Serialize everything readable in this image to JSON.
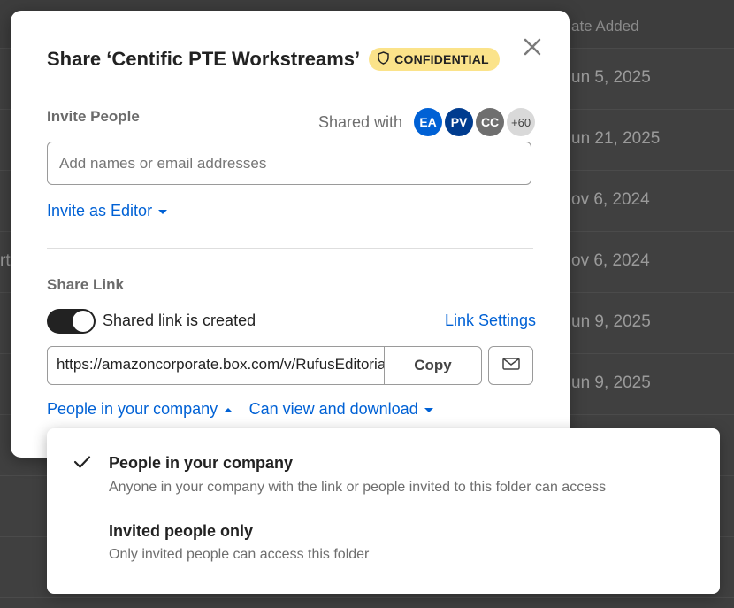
{
  "background": {
    "header_label": "ate Added",
    "rows": [
      {
        "date": "un 5, 2025"
      },
      {
        "date": "un 21, 2025"
      },
      {
        "date": "ov 6, 2024"
      },
      {
        "date": "ov 6, 2024",
        "left_fragment": "rt"
      },
      {
        "date": "un 9, 2025"
      },
      {
        "date": "un 9, 2025"
      }
    ]
  },
  "modal": {
    "title": "Share ‘Centific PTE Workstreams’",
    "badge": "CONFIDENTIAL",
    "invite_section_label": "Invite People",
    "shared_with_label": "Shared with",
    "avatars": [
      {
        "initials": "EA",
        "color": "#0061d5"
      },
      {
        "initials": "PV",
        "color": "#003c8f"
      },
      {
        "initials": "CC",
        "color": "#6f6f6f"
      },
      {
        "initials": "+60",
        "color": "#d9d9d9"
      }
    ],
    "invite_placeholder": "Add names or email addresses",
    "invite_role": "Invite as Editor",
    "share_link_label": "Share Link",
    "toggle_label": "Shared link is created",
    "toggle_on": true,
    "link_settings": "Link Settings",
    "url": "https://amazoncorporate.box.com/v/RufusEditorialTools",
    "copy_label": "Copy",
    "access_scope": "People in your company",
    "permission": "Can view and download"
  },
  "dropdown": {
    "options": [
      {
        "title": "People in your company",
        "desc": "Anyone in your company with the link or people invited to this folder can access",
        "selected": true
      },
      {
        "title": "Invited people only",
        "desc": "Only invited people can access this folder",
        "selected": false
      }
    ]
  },
  "colors": {
    "accent": "#0061d5",
    "badge_bg": "#fbe38a"
  }
}
